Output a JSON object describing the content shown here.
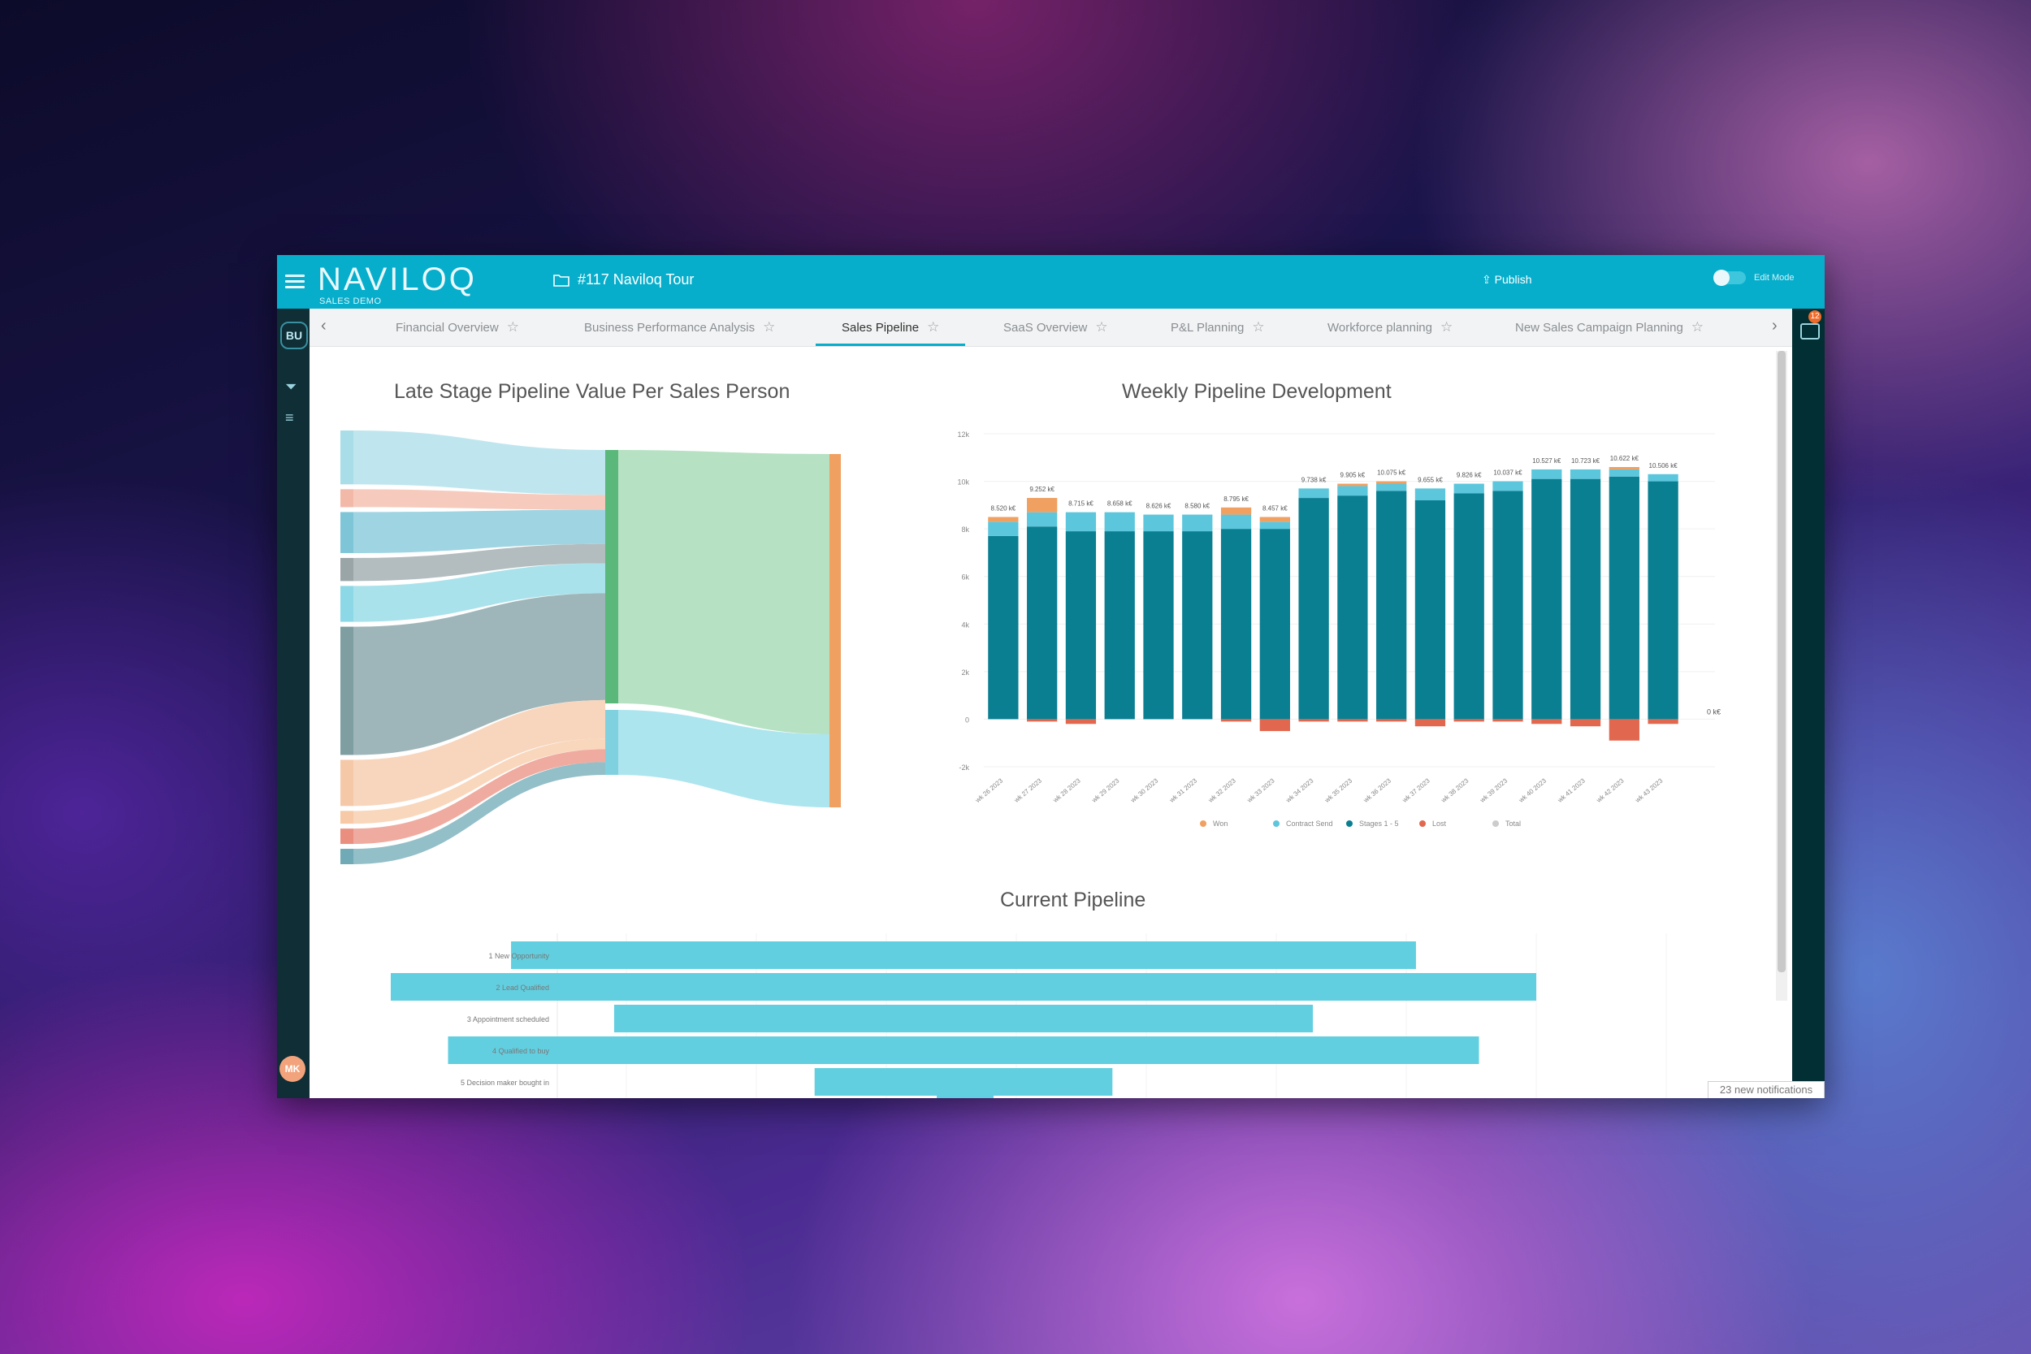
{
  "topbar": {
    "logo": "NAVILOQ",
    "logo_sub": "SALES DEMO",
    "breadcrumb": "#117 Naviloq Tour",
    "publish": "Publish",
    "edit_mode": "Edit Mode"
  },
  "sidebar": {
    "bu": "BU",
    "avatar": "MK"
  },
  "rightbar": {
    "badge": "12"
  },
  "tabs": [
    {
      "label": "Financial Overview"
    },
    {
      "label": "Business Performance Analysis"
    },
    {
      "label": "Sales Pipeline",
      "active": true
    },
    {
      "label": "SaaS Overview"
    },
    {
      "label": "P&L Planning"
    },
    {
      "label": "Workforce planning"
    },
    {
      "label": "New Sales Campaign Planning"
    }
  ],
  "panels": {
    "sankey_title": "Late Stage Pipeline Value Per Sales Person",
    "weekly_title": "Weekly Pipeline Development",
    "current_title": "Current Pipeline"
  },
  "notifications": "23 new notifications",
  "colors": {
    "accent": "#06aecb",
    "won": "#f0a060",
    "contract": "#5cc6dc",
    "stages": "#0a7f92",
    "lost": "#e2674f",
    "funnel": "#62cfe0"
  },
  "chart_data": [
    {
      "type": "bar",
      "title": "Weekly Pipeline Development",
      "stacked": true,
      "categories": [
        "wk 26 2023",
        "wk 27 2023",
        "wk 28 2023",
        "wk 29 2023",
        "wk 30 2023",
        "wk 31 2023",
        "wk 32 2023",
        "wk 33 2023",
        "wk 34 2023",
        "wk 35 2023",
        "wk 36 2023",
        "wk 37 2023",
        "wk 38 2023",
        "wk 39 2023",
        "wk 40 2023",
        "wk 41 2023",
        "wk 42 2023",
        "wk 43 2023"
      ],
      "ylim": [
        -2,
        12
      ],
      "yticks": [
        "-2k",
        "0",
        "2k",
        "4k",
        "6k",
        "8k",
        "10k",
        "12k"
      ],
      "series": [
        {
          "name": "Stages 1 - 5",
          "values": [
            7.7,
            8.1,
            7.9,
            7.9,
            7.9,
            7.9,
            8.0,
            8.0,
            9.3,
            9.4,
            9.6,
            9.2,
            9.5,
            9.6,
            10.1,
            10.1,
            10.2,
            10.0
          ]
        },
        {
          "name": "Contract Send",
          "values": [
            0.6,
            0.6,
            0.8,
            0.8,
            0.7,
            0.7,
            0.6,
            0.3,
            0.4,
            0.4,
            0.3,
            0.5,
            0.4,
            0.4,
            0.4,
            0.4,
            0.3,
            0.3
          ]
        },
        {
          "name": "Won",
          "values": [
            0.2,
            0.6,
            0,
            0,
            0,
            0,
            0.3,
            0.2,
            0,
            0.1,
            0.1,
            0,
            0,
            0,
            0,
            0,
            0.1,
            0
          ]
        },
        {
          "name": "Lost",
          "values": [
            0,
            -0.1,
            -0.2,
            0,
            0,
            0,
            -0.1,
            -0.5,
            -0.1,
            -0.1,
            -0.1,
            -0.3,
            -0.1,
            -0.1,
            -0.2,
            -0.3,
            -0.9,
            -0.2
          ]
        }
      ],
      "totals": [
        "8.520 k€",
        "9.252 k€",
        "8.715 k€",
        "8.658 k€",
        "8.626 k€",
        "8.580 k€",
        "8.795 k€",
        "8.457 k€",
        "9.738 k€",
        "9.905 k€",
        "10.075 k€",
        "9.655 k€",
        "9.826 k€",
        "10.037 k€",
        "10.527 k€",
        "10.723 k€",
        "10.622 k€",
        "10.506 k€"
      ],
      "end_label": "0 k€",
      "legend": [
        "Won",
        "Contract Send",
        "Stages 1 - 5",
        "Lost",
        "Total"
      ]
    },
    {
      "type": "bar",
      "title": "Current Pipeline",
      "orientation": "horizontal-funnel",
      "categories": [
        "1 New Opportunity",
        "2 Lead Qualified",
        "3 Appointment scheduled",
        "4 Qualified to buy",
        "5 Decision maker bought in"
      ],
      "values": [
        0.79,
        1.0,
        0.61,
        0.9,
        0.26
      ]
    },
    {
      "type": "sankey",
      "title": "Late Stage Pipeline Value Per Sales Person",
      "flows": [
        {
          "size": 42,
          "color": "#a9dde8"
        },
        {
          "size": 14,
          "color": "#f3b9a8"
        },
        {
          "size": 32,
          "color": "#7fc5d8"
        },
        {
          "size": 18,
          "color": "#9aa5a8"
        },
        {
          "size": 28,
          "color": "#8dd8e6"
        },
        {
          "size": 100,
          "color": "#7e9ea2"
        },
        {
          "size": 36,
          "color": "#f5c8a8"
        },
        {
          "size": 10,
          "color": "#f7c9a6"
        },
        {
          "size": 12,
          "color": "#ea8f80"
        },
        {
          "size": 12,
          "color": "#6faab6"
        }
      ]
    }
  ]
}
